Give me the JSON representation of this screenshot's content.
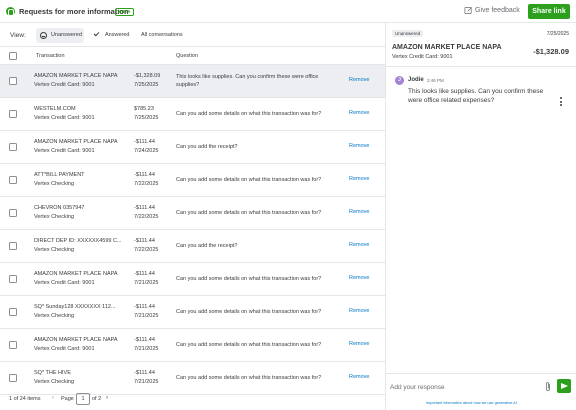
{
  "header": {
    "title": "Requests for more information",
    "badge": "BETA",
    "feedback_label": "Give feedback",
    "share_label": "Share link"
  },
  "viewbar": {
    "label": "View:",
    "options": [
      "Unanswered",
      "Answered",
      "All conversations"
    ],
    "selected": "Unanswered"
  },
  "table": {
    "columns": [
      "Transaction",
      "Question"
    ],
    "remove_label": "Remove",
    "rows": [
      {
        "name": "AMAZON MARKET PLACE NAPA",
        "account": "Vertex Credit Card: 9001",
        "amount": "-$1,328.09",
        "date": "7/25/2025",
        "question": "This looks like supplies. Can you confirm these were office supplies?",
        "selected": true
      },
      {
        "name": "WESTELM.COM",
        "account": "Vertex Credit Card: 9001",
        "amount": "$785.23",
        "date": "7/25/2025",
        "question": "Can you add some details on what this transaction was for?"
      },
      {
        "name": "AMAZON MARKET PLACE NAPA",
        "account": "Vertex Credit Card: 9001",
        "amount": "-$111.44",
        "date": "7/24/2025",
        "question": "Can you add the receipt?"
      },
      {
        "name": "ATT*BILL PAYMENT",
        "account": "Vertex Checking",
        "amount": "-$111.44",
        "date": "7/22/2025",
        "question": "Can you add some details on what this transaction was for?"
      },
      {
        "name": "CHEVRON 0357947",
        "account": "Vertex Checking",
        "amount": "-$111.44",
        "date": "7/22/2025",
        "question": "Can you add some details on what this transaction was for?"
      },
      {
        "name": "DIRECT DEP ID: XXXXXX4599 C...",
        "account": "Vertex Checking",
        "amount": "-$111.44",
        "date": "7/22/2025",
        "question": "Can you add the receipt?"
      },
      {
        "name": "AMAZON MARKET PLACE NAPA",
        "account": "Vertex Credit Card: 9001",
        "amount": "-$111.44",
        "date": "7/21/2025",
        "question": "Can you add some details on what this transaction was for?"
      },
      {
        "name": "SQ* Sunday128 XXXXXXX 112...",
        "account": "Vertex Checking",
        "amount": "-$111.44",
        "date": "7/21/2025",
        "question": "Can you add some details on what this transaction was for?"
      },
      {
        "name": "AMAZON MARKET PLACE NAPA",
        "account": "Vertex Credit Card: 9001",
        "amount": "-$111.44",
        "date": "7/21/2025",
        "question": "Can you add some details on what this transaction was for?"
      },
      {
        "name": "SQ* THE HIVE",
        "account": "Vertex Checking",
        "amount": "-$111.44",
        "date": "7/21/2025",
        "question": "Can you add some details on what this transaction was for?"
      }
    ]
  },
  "footer": {
    "count": "1 of 24 items",
    "page_label": "Page",
    "page_value": "1",
    "of_label": "of 2"
  },
  "detail": {
    "status": "Unanswered",
    "date": "7/25/2025",
    "name": "AMAZON MARKET PLACE NAPA",
    "account": "Vertex Credit Card: 9001",
    "amount": "-$1,328.09",
    "message": {
      "avatar": "J",
      "author": "Jodie",
      "time": "2:46 PM",
      "text": "This looks like supplies. Can you confirm these were office related expenses?"
    },
    "reply_placeholder": "Add your response",
    "ai_note": "Important information about how we use generative AI"
  },
  "colors": {
    "brand_green": "#2ca01c",
    "link_blue": "#0077c5",
    "selected_row": "#eceef1",
    "avatar_purple": "#a283d5"
  },
  "icons": [
    "quickbooks-logo-icon",
    "feedback-icon",
    "circle-check-icon",
    "check-icon",
    "chevron-left-icon",
    "chevron-right-icon",
    "kebab-menu-icon",
    "paperclip-icon",
    "send-icon"
  ]
}
